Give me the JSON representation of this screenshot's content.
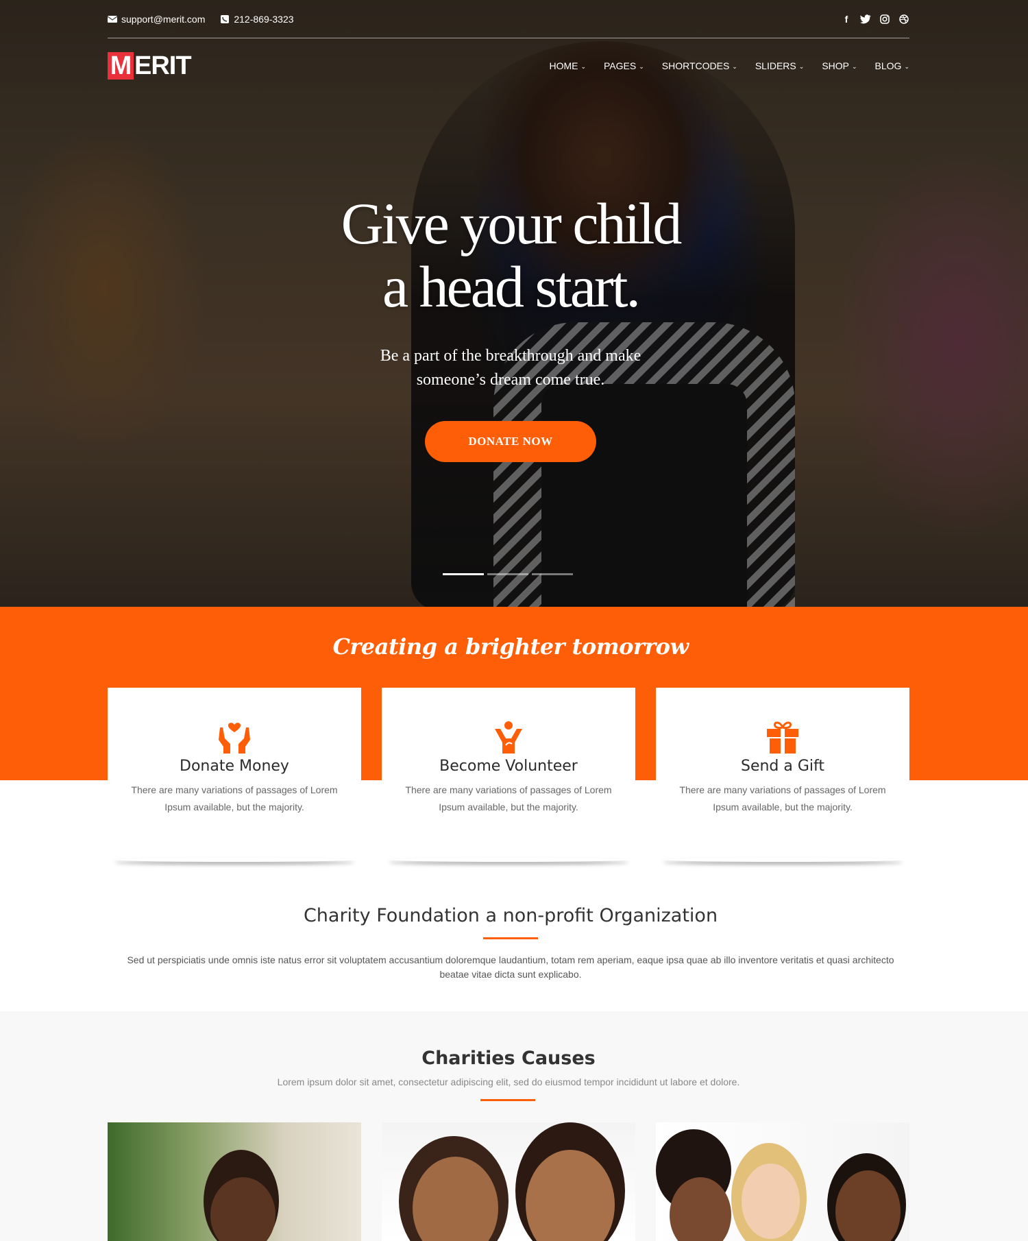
{
  "topbar": {
    "email": "support@merit.com",
    "phone": "212-869-3323",
    "social_icons": [
      "facebook-icon",
      "twitter-icon",
      "instagram-icon",
      "dribbble-icon"
    ]
  },
  "logo": {
    "initial": "M",
    "rest": "ERIT"
  },
  "nav": {
    "items": [
      {
        "label": "HOME"
      },
      {
        "label": "PAGES"
      },
      {
        "label": "SHORTCODES"
      },
      {
        "label": "SLIDERS"
      },
      {
        "label": "SHOP"
      },
      {
        "label": "BLOG"
      }
    ]
  },
  "hero": {
    "title_line1": "Give your child",
    "title_line2": "a head start.",
    "subtitle_line1": "Be a part of the breakthrough and make",
    "subtitle_line2": "someone’s dream come true.",
    "cta": "DONATE NOW",
    "slides": 3,
    "active_slide": 1
  },
  "band": {
    "title": "Creating a brighter tomorrow"
  },
  "cards": [
    {
      "icon": "donate-hands-icon",
      "title": "Donate Money",
      "text": "There are many variations of passages of Lorem Ipsum available, but the majority."
    },
    {
      "icon": "volunteer-icon",
      "title": "Become Volunteer",
      "text": "There are many variations of passages of Lorem Ipsum available, but the majority."
    },
    {
      "icon": "gift-icon",
      "title": "Send a Gift",
      "text": "There are many variations of passages of Lorem Ipsum available, but the majority."
    }
  ],
  "about": {
    "title": "Charity Foundation a non-profit Organization",
    "text": "Sed ut perspiciatis unde omnis iste natus error sit voluptatem accusantium doloremque laudantium, totam rem aperiam, eaque ipsa quae ab illo inventore veritatis et quasi architecto beatae vitae dicta sunt explicabo."
  },
  "causes": {
    "title": "Charities Causes",
    "subtitle": "Lorem ipsum dolor sit amet, consectetur adipiscing elit, sed do eiusmod tempor incididunt ut labore et dolore."
  },
  "colors": {
    "accent": "#fd5e07",
    "logo_red": "#e8313b"
  }
}
